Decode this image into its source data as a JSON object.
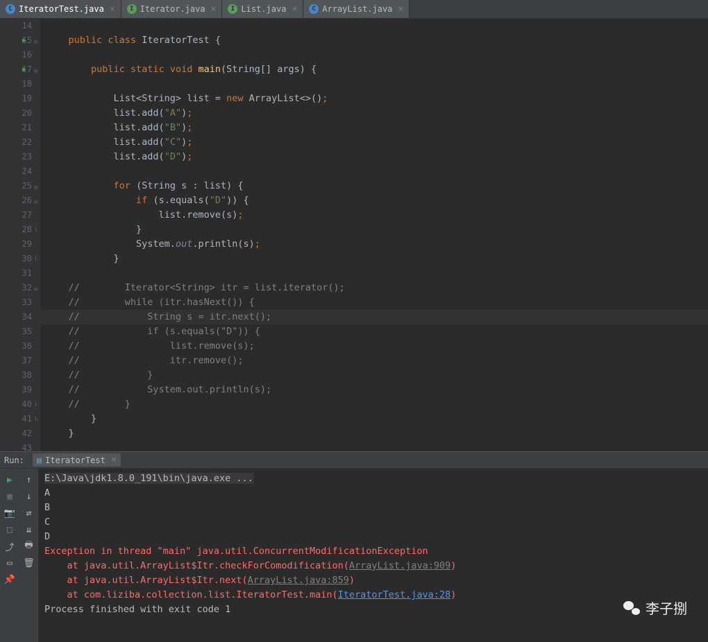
{
  "tabs": [
    {
      "label": "IteratorTest.java",
      "type": "class",
      "active": true
    },
    {
      "label": "Iterator.java",
      "type": "iface",
      "active": false
    },
    {
      "label": "List.java",
      "type": "iface",
      "active": false
    },
    {
      "label": "ArrayList.java",
      "type": "class",
      "active": false
    }
  ],
  "editor": {
    "startLine": 14,
    "lines": [
      {
        "n": 14,
        "tokens": []
      },
      {
        "n": 15,
        "run": true,
        "fold": "-",
        "tokens": [
          {
            "t": "    ",
            "c": ""
          },
          {
            "t": "public class",
            "c": "kw"
          },
          {
            "t": " ",
            "c": ""
          },
          {
            "t": "IteratorTest",
            "c": "cls"
          },
          {
            "t": " {",
            "c": ""
          }
        ]
      },
      {
        "n": 16,
        "tokens": []
      },
      {
        "n": 17,
        "run": true,
        "fold": "-",
        "tokens": [
          {
            "t": "        ",
            "c": ""
          },
          {
            "t": "public static void",
            "c": "kw"
          },
          {
            "t": " ",
            "c": ""
          },
          {
            "t": "main",
            "c": "mth"
          },
          {
            "t": "(String[] args) {",
            "c": ""
          }
        ]
      },
      {
        "n": 18,
        "tokens": []
      },
      {
        "n": 19,
        "tokens": [
          {
            "t": "            List<String> list = ",
            "c": ""
          },
          {
            "t": "new",
            "c": "kw"
          },
          {
            "t": " ArrayList<>()",
            "c": ""
          },
          {
            "t": ";",
            "c": "semi"
          }
        ]
      },
      {
        "n": 20,
        "tokens": [
          {
            "t": "            list.add(",
            "c": ""
          },
          {
            "t": "\"A\"",
            "c": "str"
          },
          {
            "t": ")",
            "c": ""
          },
          {
            "t": ";",
            "c": "semi"
          }
        ]
      },
      {
        "n": 21,
        "tokens": [
          {
            "t": "            list.add(",
            "c": ""
          },
          {
            "t": "\"B\"",
            "c": "str"
          },
          {
            "t": ")",
            "c": ""
          },
          {
            "t": ";",
            "c": "semi"
          }
        ]
      },
      {
        "n": 22,
        "tokens": [
          {
            "t": "            list.add(",
            "c": ""
          },
          {
            "t": "\"C\"",
            "c": "str"
          },
          {
            "t": ")",
            "c": ""
          },
          {
            "t": ";",
            "c": "semi"
          }
        ]
      },
      {
        "n": 23,
        "tokens": [
          {
            "t": "            list.add(",
            "c": ""
          },
          {
            "t": "\"D\"",
            "c": "str"
          },
          {
            "t": ")",
            "c": ""
          },
          {
            "t": ";",
            "c": "semi"
          }
        ]
      },
      {
        "n": 24,
        "tokens": []
      },
      {
        "n": 25,
        "fold": "-",
        "tokens": [
          {
            "t": "            ",
            "c": ""
          },
          {
            "t": "for",
            "c": "kw"
          },
          {
            "t": " (String s : list) {",
            "c": ""
          }
        ]
      },
      {
        "n": 26,
        "fold": "-",
        "tokens": [
          {
            "t": "                ",
            "c": ""
          },
          {
            "t": "if",
            "c": "kw"
          },
          {
            "t": " (s.equals(",
            "c": ""
          },
          {
            "t": "\"D\"",
            "c": "str"
          },
          {
            "t": ")) {",
            "c": ""
          }
        ]
      },
      {
        "n": 27,
        "tokens": [
          {
            "t": "                    list.remove(s)",
            "c": ""
          },
          {
            "t": ";",
            "c": "semi"
          }
        ]
      },
      {
        "n": 28,
        "fold": "}",
        "tokens": [
          {
            "t": "                }",
            "c": ""
          }
        ]
      },
      {
        "n": 29,
        "tokens": [
          {
            "t": "                System.",
            "c": ""
          },
          {
            "t": "out",
            "c": "field"
          },
          {
            "t": ".println(s)",
            "c": ""
          },
          {
            "t": ";",
            "c": "semi"
          }
        ]
      },
      {
        "n": 30,
        "fold": "}",
        "tokens": [
          {
            "t": "            }",
            "c": ""
          }
        ]
      },
      {
        "n": 31,
        "tokens": []
      },
      {
        "n": 32,
        "fold": "-",
        "tokens": [
          {
            "t": "    //        Iterator<String> itr = list.iterator();",
            "c": "cmt"
          }
        ]
      },
      {
        "n": 33,
        "tokens": [
          {
            "t": "    //        while (itr.hasNext()) {",
            "c": "cmt"
          }
        ]
      },
      {
        "n": 34,
        "hl": true,
        "tokens": [
          {
            "t": "    //            String s = itr.next();",
            "c": "cmt"
          }
        ]
      },
      {
        "n": 35,
        "tokens": [
          {
            "t": "    //            if (s.equals(\"D\")) {",
            "c": "cmt"
          }
        ]
      },
      {
        "n": 36,
        "tokens": [
          {
            "t": "    //                list.remove(s);",
            "c": "cmt"
          }
        ]
      },
      {
        "n": 37,
        "tokens": [
          {
            "t": "    //                itr.remove();",
            "c": "cmt"
          }
        ]
      },
      {
        "n": 38,
        "tokens": [
          {
            "t": "    //            }",
            "c": "cmt"
          }
        ]
      },
      {
        "n": 39,
        "tokens": [
          {
            "t": "    //            System.out.println(s);",
            "c": "cmt"
          }
        ]
      },
      {
        "n": 40,
        "fold": "}",
        "tokens": [
          {
            "t": "    //        }",
            "c": "cmt"
          }
        ]
      },
      {
        "n": 41,
        "fold": "}",
        "tokens": [
          {
            "t": "        }",
            "c": ""
          }
        ]
      },
      {
        "n": 42,
        "tokens": [
          {
            "t": "    }",
            "c": ""
          }
        ]
      },
      {
        "n": 43,
        "tokens": []
      }
    ]
  },
  "runPanel": {
    "label": "Run:",
    "tabLabel": "IteratorTest",
    "console": [
      {
        "segs": [
          {
            "t": "E:\\Java\\jdk1.8.0_191\\bin\\java.exe ...",
            "c": "hdr"
          }
        ]
      },
      {
        "segs": [
          {
            "t": "A",
            "c": ""
          }
        ]
      },
      {
        "segs": [
          {
            "t": "B",
            "c": ""
          }
        ]
      },
      {
        "segs": [
          {
            "t": "C",
            "c": ""
          }
        ]
      },
      {
        "segs": [
          {
            "t": "D",
            "c": ""
          }
        ]
      },
      {
        "segs": [
          {
            "t": "Exception in thread \"main\" java.util.ConcurrentModificationException",
            "c": "err"
          }
        ]
      },
      {
        "segs": [
          {
            "t": "    at java.util.ArrayList$Itr.checkForComodification(",
            "c": "err"
          },
          {
            "t": "ArrayList.java:909",
            "c": "link gray"
          },
          {
            "t": ")",
            "c": "err"
          }
        ]
      },
      {
        "segs": [
          {
            "t": "    at java.util.ArrayList$Itr.next(",
            "c": "err"
          },
          {
            "t": "ArrayList.java:859",
            "c": "link gray"
          },
          {
            "t": ")",
            "c": "err"
          }
        ]
      },
      {
        "segs": [
          {
            "t": "    at com.liziba.collection.list.IteratorTest.main(",
            "c": "err"
          },
          {
            "t": "IteratorTest.java:28",
            "c": "link"
          },
          {
            "t": ")",
            "c": "err"
          }
        ]
      },
      {
        "segs": [
          {
            "t": "",
            "c": ""
          }
        ]
      },
      {
        "segs": [
          {
            "t": "Process finished with exit code 1",
            "c": ""
          }
        ]
      }
    ]
  },
  "watermark": "李子捌"
}
